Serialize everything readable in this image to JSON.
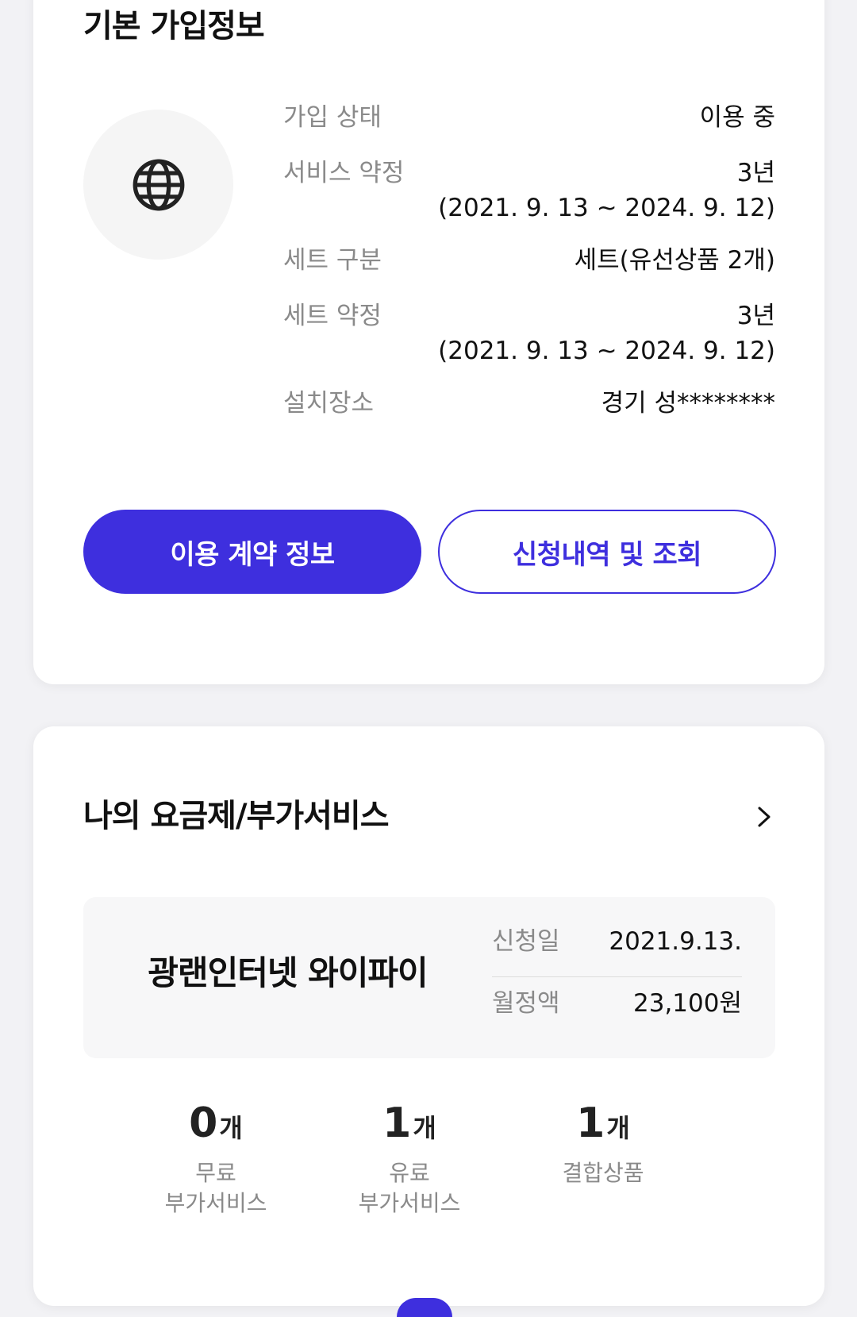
{
  "basic_info": {
    "title": "기본 가입정보",
    "rows": [
      {
        "label": "가입 상태",
        "value": "이용 중",
        "value2": ""
      },
      {
        "label": "서비스 약정",
        "value": "3년",
        "value2": "(2021. 9. 13 ~ 2024. 9. 12)"
      },
      {
        "label": "세트 구분",
        "value": "세트(유선상품 2개)",
        "value2": ""
      },
      {
        "label": "세트 약정",
        "value": "3년",
        "value2": "(2021. 9. 13 ~ 2024. 9. 12)"
      },
      {
        "label": "설치장소",
        "value": "경기 성********",
        "value2": ""
      }
    ],
    "buttons": {
      "contract_info": "이용 계약 정보",
      "application_history": "신청내역 및 조회"
    },
    "icon": "globe-icon"
  },
  "my_plan": {
    "title": "나의 요금제/부가서비스",
    "plan_name": "광랜인터넷 와이파이",
    "apply_date_label": "신청일",
    "apply_date": "2021.9.13.",
    "monthly_fee_label": "월정액",
    "monthly_fee": "23,100원",
    "stats": [
      {
        "count": "0",
        "unit": "개",
        "label": "무료\n부가서비스"
      },
      {
        "count": "1",
        "unit": "개",
        "label": "유료\n부가서비스"
      },
      {
        "count": "1",
        "unit": "개",
        "label": "결합상품"
      }
    ]
  },
  "colors": {
    "accent": "#3e2fde",
    "label_gray": "#8a8a8a"
  }
}
